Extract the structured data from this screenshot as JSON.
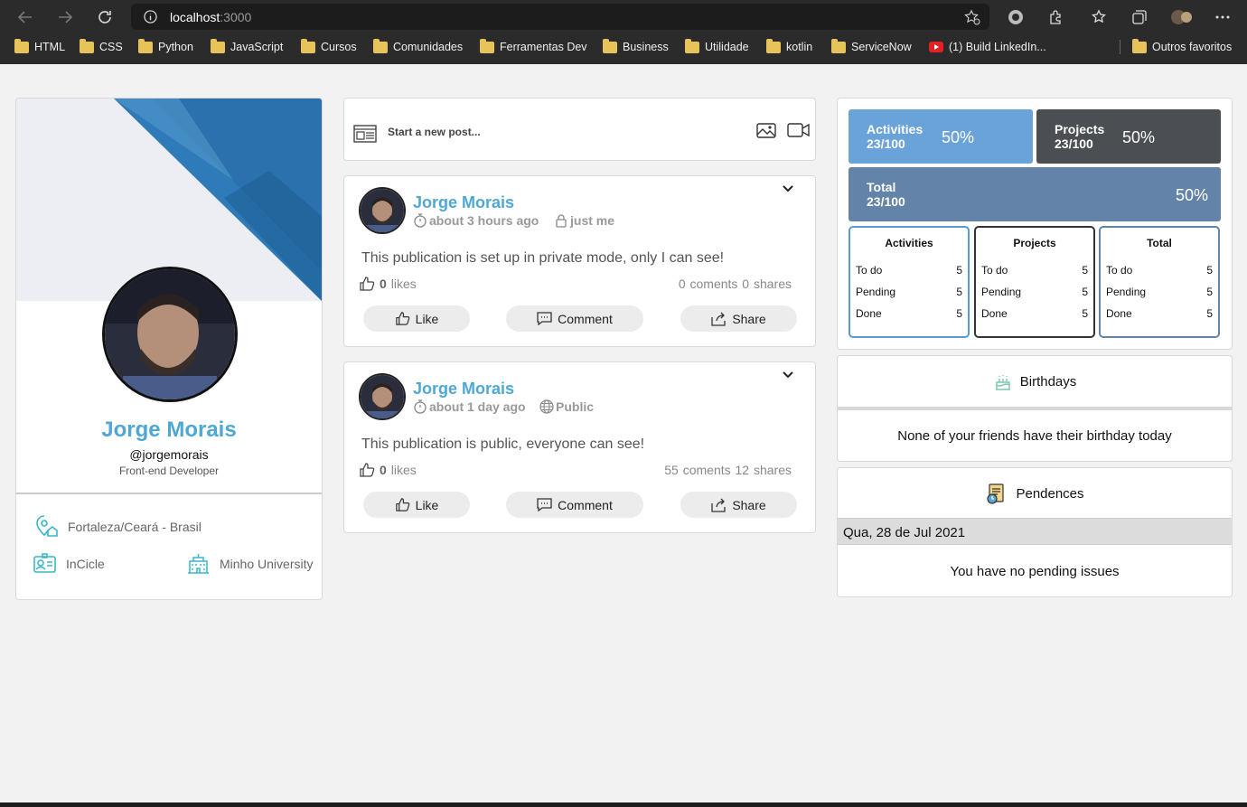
{
  "browser": {
    "url_host": "localhost",
    "url_port": ":3000",
    "bookmarks": [
      {
        "label": "HTML",
        "icon": "folder-icon"
      },
      {
        "label": "CSS",
        "icon": "folder-icon"
      },
      {
        "label": "Python",
        "icon": "folder-icon"
      },
      {
        "label": "JavaScript",
        "icon": "folder-icon"
      },
      {
        "label": "Cursos",
        "icon": "folder-icon"
      },
      {
        "label": "Comunidades",
        "icon": "folder-icon"
      },
      {
        "label": "Ferramentas Dev",
        "icon": "folder-icon"
      },
      {
        "label": "Business",
        "icon": "folder-icon"
      },
      {
        "label": "Utilidade",
        "icon": "folder-icon"
      },
      {
        "label": "kotlin",
        "icon": "folder-icon"
      },
      {
        "label": "ServiceNow",
        "icon": "folder-icon"
      },
      {
        "label": "(1) Build LinkedIn...",
        "icon": "youtube-icon"
      }
    ],
    "other_favorites": "Outros favoritos"
  },
  "profile": {
    "name": "Jorge Morais",
    "username": "@jorgemorais",
    "role": "Front-end Developer",
    "location": "Fortaleza/Ceará - Brasil",
    "company": "InCicle",
    "university": "Minho University"
  },
  "new_post": {
    "placeholder": "Start a new post..."
  },
  "posts": [
    {
      "author": "Jorge Morais",
      "time": "about 3 hours ago",
      "visibility": "just me",
      "text": "This publication is set up in private mode, only I can see!",
      "likes_count": "0",
      "likes_label": "likes",
      "stats": "0 coments  0 shares",
      "like_label": "Like",
      "comment_label": "Comment",
      "share_label": "Share"
    },
    {
      "author": "Jorge Morais",
      "time": "about 1 day ago",
      "visibility": "Public",
      "text": "This publication is public, everyone can see!",
      "likes_count": "0",
      "likes_label": "likes",
      "stats": "55 coments  12 shares",
      "like_label": "Like",
      "comment_label": "Comment",
      "share_label": "Share"
    }
  ],
  "stats": {
    "activities": {
      "label": "Activities",
      "count": "23/100",
      "percent": "50%"
    },
    "projects": {
      "label": "Projects",
      "count": "23/100",
      "percent": "50%"
    },
    "total": {
      "label": "Total",
      "count": "23/100",
      "percent": "50%"
    },
    "colors": {
      "activities": "#6aa3d9",
      "projects": "#4b4f54",
      "total": "#6384a8"
    },
    "tables": [
      {
        "title": "Activities",
        "rows": [
          {
            "label": "To do",
            "value": "5"
          },
          {
            "label": "Pending",
            "value": "5"
          },
          {
            "label": "Done",
            "value": "5"
          }
        ]
      },
      {
        "title": "Projects",
        "rows": [
          {
            "label": "To do",
            "value": "5"
          },
          {
            "label": "Pending",
            "value": "5"
          },
          {
            "label": "Done",
            "value": "5"
          }
        ]
      },
      {
        "title": "Total",
        "rows": [
          {
            "label": "To do",
            "value": "5"
          },
          {
            "label": "Pending",
            "value": "5"
          },
          {
            "label": "Done",
            "value": "5"
          }
        ]
      }
    ]
  },
  "birthdays": {
    "title": "Birthdays",
    "message": "None of your friends have their birthday today"
  },
  "pendences": {
    "title": "Pendences",
    "date": "Qua, 28 de Jul 2021",
    "message": "You have no pending issues"
  },
  "theme": {
    "accent": "#4fa8d4"
  }
}
